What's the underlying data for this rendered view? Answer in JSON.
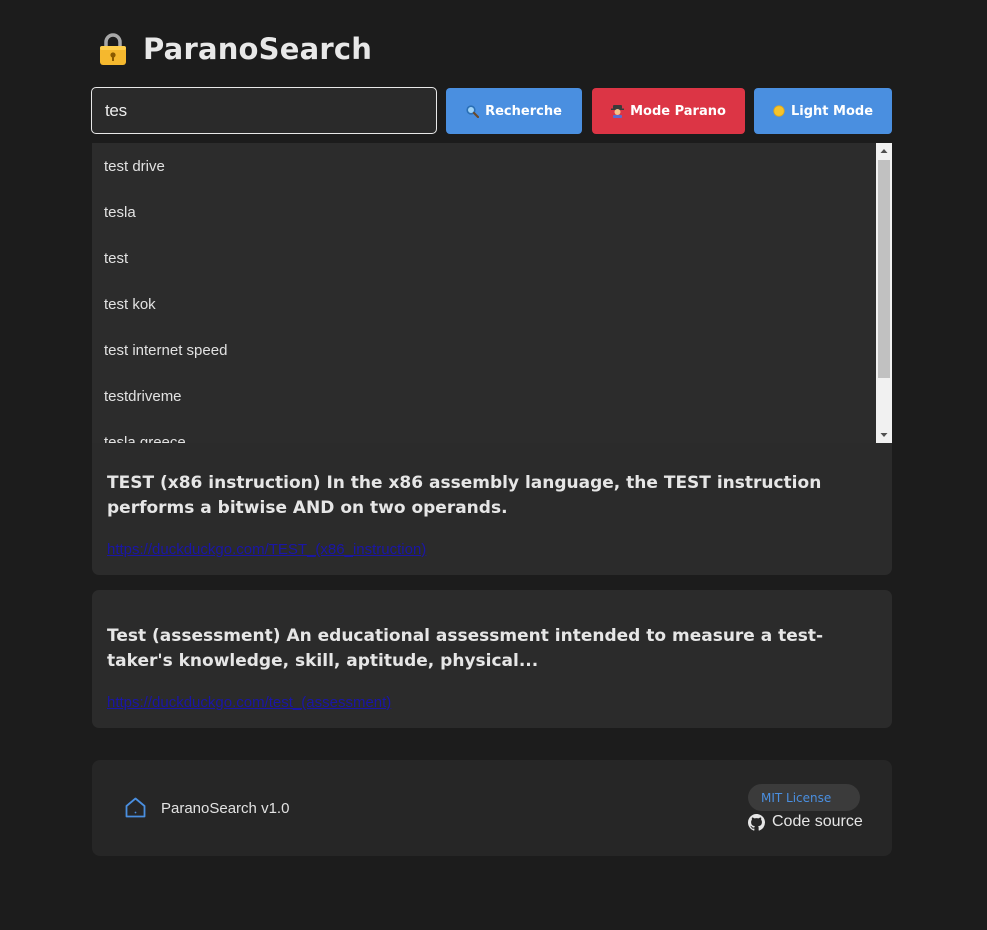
{
  "header": {
    "title": "ParanoSearch",
    "icon": "lock-icon"
  },
  "search": {
    "value": "tes",
    "placeholder": ""
  },
  "buttons": {
    "search_label": "Recherche",
    "parano_label": "Mode Parano",
    "light_label": "Light Mode"
  },
  "suggestions": [
    "test drive",
    "tesla",
    "test",
    "test kok",
    "test internet speed",
    "testdriveme",
    "tesla greece"
  ],
  "results": [
    {
      "title": "TEST (x86 instruction) In the x86 assembly language, the TEST instruction performs a bitwise AND on two operands.",
      "url": "https://duckduckgo.com/TEST_(x86_instruction)"
    },
    {
      "title": "Test (assessment) An educational assessment intended to measure a test-taker's knowledge, skill, aptitude, physical...",
      "url": "https://duckduckgo.com/test_(assessment)"
    }
  ],
  "footer": {
    "version": "ParanoSearch v1.0",
    "license": "MIT License",
    "source": "Code source"
  },
  "colors": {
    "background": "#1c1c1c",
    "accent_blue": "#4a8fe0",
    "accent_red": "#dc3545",
    "link": "#1a16a6"
  }
}
